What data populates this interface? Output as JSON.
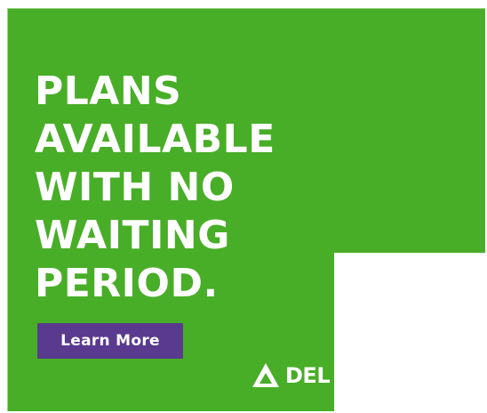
{
  "ad": {
    "headline_lines": [
      "PLANS",
      "AVAILABLE",
      "WITH NO",
      "WAITING",
      "PERIOD."
    ],
    "cta_label": "Learn More",
    "brand_text_visible": "DEL",
    "brand_icon": "delta-triangle-icon",
    "colors": {
      "background": "#48ae27",
      "cta": "#5a3a8e",
      "text": "#ffffff"
    }
  }
}
